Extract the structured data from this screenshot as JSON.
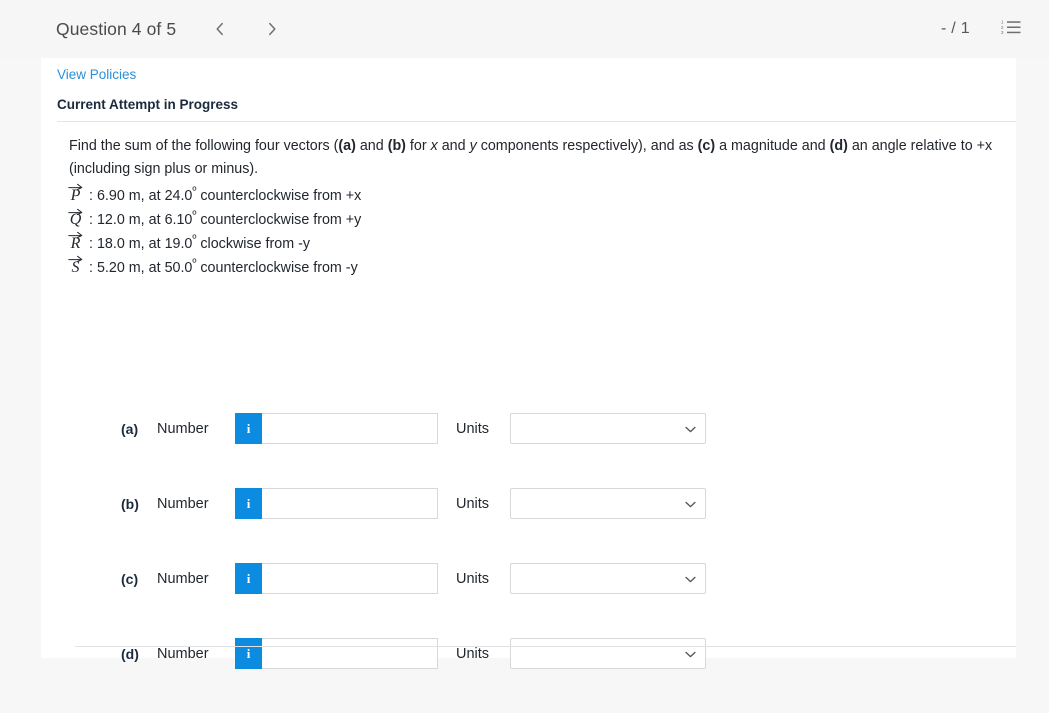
{
  "header": {
    "question_title": "Question 4 of 5",
    "prev_label": "Previous question",
    "next_label": "Next question",
    "score": "- / 1",
    "menu_label": "Question list",
    "prev_icon": "chevron-left-icon",
    "next_icon": "chevron-right-icon",
    "menu_icon": "ordered-list-icon",
    "background": "#f6f6f7"
  },
  "card": {
    "view_policies": "View Policies",
    "attempt_status": "Current Attempt in Progress",
    "link_color": "#2b90d9"
  },
  "question": {
    "prompt_parts": {
      "p1": "Find the sum of the following four vectors (",
      "b_a": "(a)",
      "p2": " and ",
      "b_b": "(b)",
      "p3": " for ",
      "i_x": "x",
      "p4": " and ",
      "i_y": "y",
      "p5": " components respectively), and as ",
      "b_c": "(c)",
      "p6": " a magnitude and ",
      "b_d": "(d)",
      "p7": " an angle relative to +x (including sign plus or minus)."
    },
    "vectors": [
      {
        "symbol": "P",
        "separator": ":",
        "magnitude": "6.90 m,",
        "at": "at",
        "angle": "24.0",
        "degree": "º",
        "direction": "counterclockwise from +x"
      },
      {
        "symbol": "Q",
        "separator": ":",
        "magnitude": "12.0 m,",
        "at": "at",
        "angle": "6.10",
        "degree": "º",
        "direction": "counterclockwise from +y"
      },
      {
        "symbol": "R",
        "separator": ":",
        "magnitude": "18.0 m,",
        "at": "at",
        "angle": "19.0",
        "degree": "º",
        "direction": "clockwise from -y"
      },
      {
        "symbol": "S",
        "separator": ":",
        "magnitude": "5.20 m,",
        "at": "at",
        "angle": "50.0",
        "degree": "º",
        "direction": "counterclockwise from -y"
      }
    ]
  },
  "answers": {
    "number_label": "Number",
    "units_label": "Units",
    "info_icon": "info-icon",
    "info_glyph": "i",
    "info_color": "#0c8ce0",
    "input_placeholder": "",
    "select_placeholder": "",
    "rows": [
      {
        "part": "(a)",
        "number_value": "",
        "units_value": ""
      },
      {
        "part": "(b)",
        "number_value": "",
        "units_value": ""
      },
      {
        "part": "(c)",
        "number_value": "",
        "units_value": ""
      },
      {
        "part": "(d)",
        "number_value": "",
        "units_value": ""
      }
    ]
  }
}
